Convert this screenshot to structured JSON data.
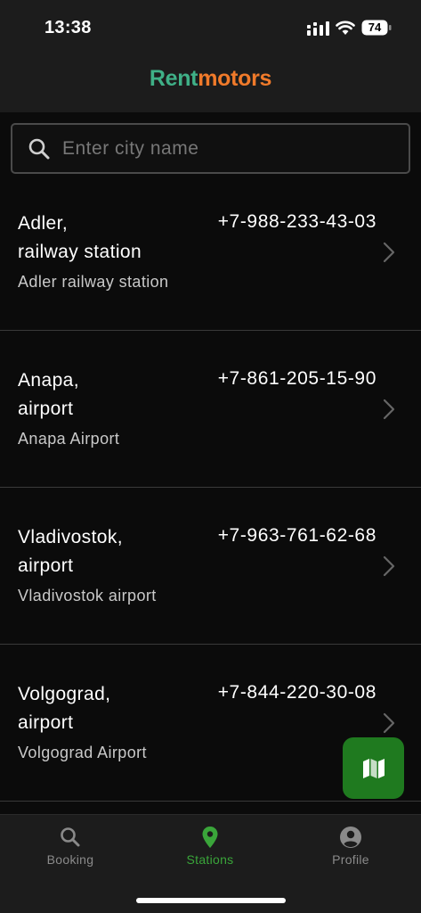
{
  "status_bar": {
    "time": "13:38",
    "battery": "74"
  },
  "header": {
    "logo_part1": "Rent",
    "logo_part2": "motors",
    "logo_color1": "#3fb087",
    "logo_color2": "#f07a2a"
  },
  "search": {
    "placeholder": "Enter city name",
    "value": ""
  },
  "stations": [
    {
      "name": "Adler,\nrailway station",
      "phone": "+7-988-233-43-03",
      "description": "Adler railway station"
    },
    {
      "name": "Anapa,\nairport",
      "phone": "+7-861-205-15-90",
      "description": "Anapa Airport"
    },
    {
      "name": "Vladivostok,\nairport",
      "phone": "+7-963-761-62-68",
      "description": "Vladivostok airport"
    },
    {
      "name": "Volgograd,\nairport",
      "phone": "+7-844-220-30-08",
      "description": "Volgograd Airport"
    }
  ],
  "map_button": {
    "icon": "map-icon",
    "color": "#1f7a1f"
  },
  "tabbar": {
    "tabs": [
      {
        "label": "Booking",
        "icon": "search-icon"
      },
      {
        "label": "Stations",
        "icon": "location-pin-icon"
      },
      {
        "label": "Profile",
        "icon": "user-circle-icon"
      }
    ],
    "active_color": "#3aa53a",
    "inactive_color": "#8a8a8a"
  }
}
